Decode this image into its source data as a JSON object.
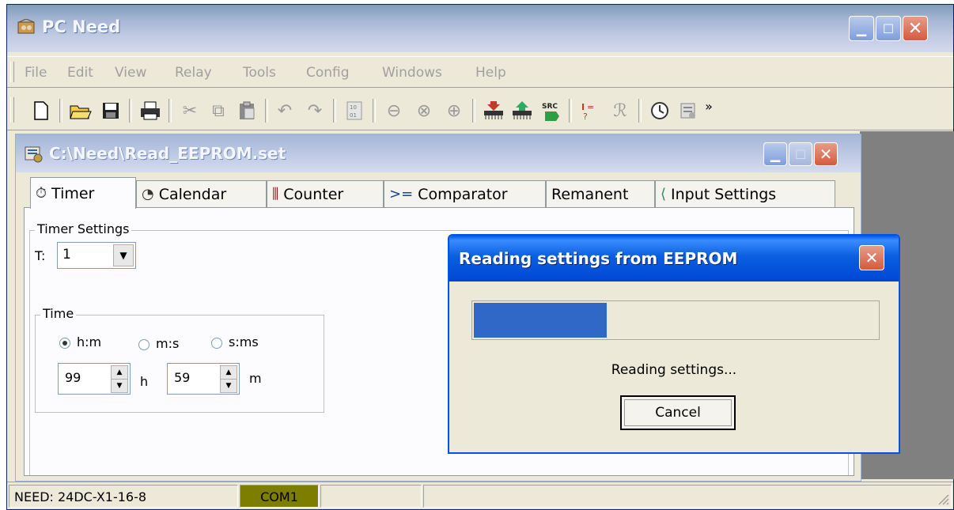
{
  "app": {
    "title": "PC Need"
  },
  "menu": [
    "File",
    "Edit",
    "View",
    "Relay",
    "Tools",
    "Config",
    "Windows",
    "Help"
  ],
  "toolbar": {
    "icons": [
      "new-icon",
      "open-icon",
      "save-icon",
      "print-icon",
      "cut-icon",
      "copy-icon",
      "paste-icon",
      "undo-icon",
      "redo-icon",
      "binary-icon",
      "zoom-out-icon",
      "zoom-reset-icon",
      "zoom-in-icon",
      "download-icon",
      "upload-icon",
      "src-icon",
      "formula-icon",
      "relay-icon",
      "clock-icon",
      "settings-icon"
    ],
    "more": "»",
    "src_label": "SRC"
  },
  "child": {
    "title": "C:\\Need\\Read_EEPROM.set",
    "tabs": [
      {
        "label": "Timer",
        "icon": "timer-icon",
        "active": true
      },
      {
        "label": "Calendar",
        "icon": "calendar-icon"
      },
      {
        "label": "Counter",
        "icon": "counter-icon"
      },
      {
        "label": "Comparator",
        "icon": "comparator-icon",
        "glyph": ">="
      },
      {
        "label": "Remanent"
      },
      {
        "label": "Input Settings",
        "icon": "input-icon"
      }
    ],
    "timer": {
      "group_label": "Timer Settings",
      "t_label": "T:",
      "t_value": "1",
      "time_group_label": "Time",
      "radios": [
        {
          "label": "h:m",
          "checked": true
        },
        {
          "label": "m:s",
          "checked": false
        },
        {
          "label": "s:ms",
          "checked": false
        }
      ],
      "spin1_value": "99",
      "spin1_unit": "h",
      "spin2_value": "59",
      "spin2_unit": "m"
    }
  },
  "status": {
    "device": "NEED: 24DC-X1-16-8",
    "port": "COM1",
    "port_color": "#7D7D00"
  },
  "dialog": {
    "title": "Reading settings from EEPROM",
    "progress_fraction": 0.33,
    "status_text": "Reading settings...",
    "cancel_label": "Cancel"
  }
}
